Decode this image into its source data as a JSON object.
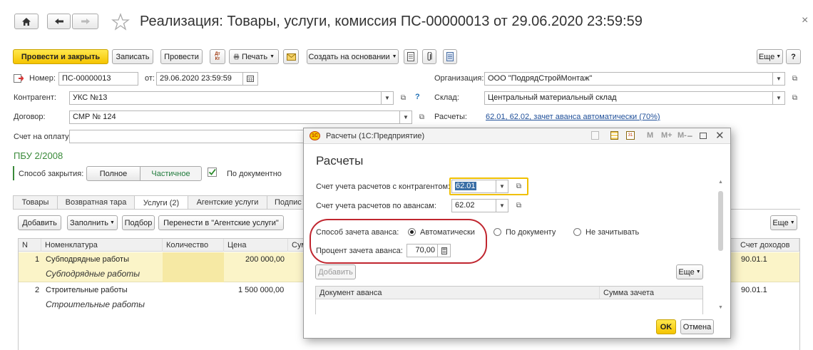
{
  "window": {
    "title": "Реализация: Товары, услуги, комиссия ПС-00000013 от 29.06.2020 23:59:59",
    "close_glyph": "×"
  },
  "toolbar": {
    "post_close": "Провести и закрыть",
    "save": "Записать",
    "post": "Провести",
    "dtkt": "Дт Кт",
    "print": "Печать",
    "create_based": "Создать на основании",
    "more": "Еще"
  },
  "header": {
    "number_label": "Номер:",
    "number_value": "ПС-00000013",
    "date_label": "от:",
    "date_value": "29.06.2020 23:59:59",
    "org_label": "Организация:",
    "org_value": "ООО \"ПодрядСтройМонтаж\"",
    "contractor_label": "Контрагент:",
    "contractor_value": "УКС №13",
    "help_q": "?",
    "warehouse_label": "Склад:",
    "warehouse_value": "Центральный материальный склад",
    "contract_label": "Договор:",
    "contract_value": "СМР № 124",
    "settlements_label": "Расчеты:",
    "settlements_link": "62.01, 62.02, зачет аванса автоматически (70%)",
    "invoice_label": "Счет на оплату:",
    "pbu": "ПБУ 2/2008",
    "closing_label": "Способ закрытия:",
    "closing_full": "Полное",
    "closing_partial": "Частичное",
    "by_document": "По документно"
  },
  "tabs": [
    "Товары",
    "Возвратная тара",
    "Услуги (2)",
    "Агентские услуги",
    "Подпис"
  ],
  "table_toolbar": {
    "add": "Добавить",
    "fill": "Заполнить",
    "pick": "Подбор",
    "transfer": "Перенести в \"Агентские услуги\"",
    "more": "Еще"
  },
  "table": {
    "columns": [
      "N",
      "Номенклатура",
      "Количество",
      "Цена",
      "Сум"
    ],
    "right_column": "Счет доходов",
    "rows": [
      {
        "n": "1",
        "name": "Субподрядные работы",
        "name2": "Субподрядные работы",
        "price": "200 000,00",
        "account": "90.01.1"
      },
      {
        "n": "2",
        "name": "Строительные работы",
        "name2": "Строительные работы",
        "price": "1 500 000,00",
        "account": "90.01.1"
      }
    ]
  },
  "dialog": {
    "title": "Расчеты (1С:Предприятие)",
    "heading": "Расчеты",
    "tb_m": "M",
    "tb_mplus": "M+",
    "tb_mminus": "M-",
    "acc_label": "Счет учета расчетов с контрагентом:",
    "acc_value": "62.01",
    "adv_label": "Счет учета расчетов по авансам:",
    "adv_value": "62.02",
    "method_label": "Способ зачета аванса:",
    "method_auto": "Автоматически",
    "method_doc": "По документу",
    "method_none": "Не зачитывать",
    "percent_label": "Процент зачета аванса:",
    "percent_value": "70,00",
    "add": "Добавить",
    "more": "Еще",
    "col_doc": "Документ аванса",
    "col_sum": "Сумма зачета",
    "ok": "OK",
    "cancel": "Отмена"
  }
}
